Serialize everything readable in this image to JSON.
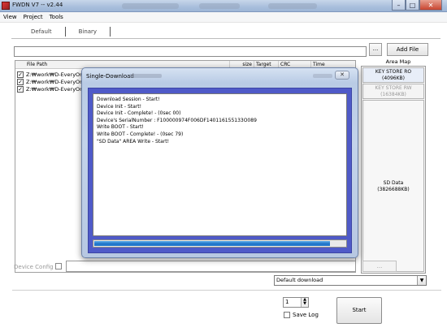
{
  "window": {
    "title": "FWDN V7 -- v2.44",
    "buttons": {
      "minimize": "–",
      "maximize": "□",
      "close": "✕"
    }
  },
  "menu": [
    "View",
    "Project",
    "Tools"
  ],
  "tabs": [
    "Default",
    "Binary"
  ],
  "toolbar": {
    "browse_label": "...",
    "add_file_label": "Add File"
  },
  "file_table": {
    "columns": [
      "File Path",
      "size",
      "Target",
      "CRC",
      "Time"
    ],
    "rows": [
      {
        "path": "Z:₩work₩D-EveryOn₩",
        "checked": true
      },
      {
        "path": "Z:₩work₩D-EveryOn₩",
        "checked": true
      },
      {
        "path": "Z:₩work₩D-EveryOn₩",
        "checked": true
      }
    ]
  },
  "area_map": {
    "title": "Area Map",
    "blocks": [
      {
        "name": "KEY STORE RO",
        "size": "(4096KB)"
      },
      {
        "name": "KEY STORE RW",
        "size": "(16384KB)"
      },
      {
        "name": "SD Data",
        "size": "(3826688KB)"
      }
    ]
  },
  "device_config": {
    "label": "Device Config",
    "button_label": "..."
  },
  "download_mode": {
    "selected": "Default download"
  },
  "count": {
    "value": "1"
  },
  "save_log": {
    "label": "Save Log"
  },
  "start_button": {
    "label": "Start"
  },
  "dialog": {
    "title": "Single-Download",
    "close_label": "✕",
    "log": [
      "Download Session - Start!",
      "Device Init - Start!",
      "Device Init - Complete! - (0sec 00)",
      "Device's SerialNumber : F100000974F006DF140116155133O089",
      "Write BOOT - Start!",
      "Write BOOT - Complete! - (0sec 79)",
      "\"SD Data\" AREA Write - Start!"
    ],
    "progress": 0.94
  },
  "colors": {
    "dialog_inner": "#4f5ac8",
    "progress_fill": "#1d72c6"
  }
}
